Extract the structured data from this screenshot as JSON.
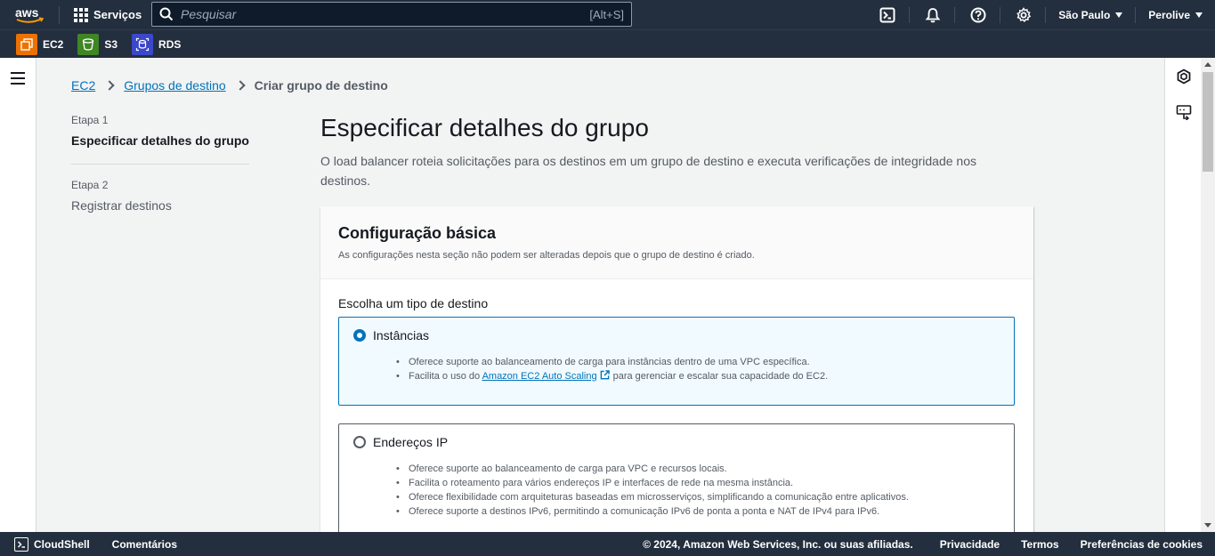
{
  "topnav": {
    "logo_text": "aws",
    "services_label": "Serviços",
    "search_placeholder": "Pesquisar",
    "search_shortcut": "[Alt+S]",
    "region": "São Paulo",
    "account": "Perolive",
    "icons": [
      "cloudshell-icon",
      "bell-icon",
      "help-icon",
      "gear-icon"
    ]
  },
  "favorites": [
    {
      "label": "EC2",
      "color": "#ed7100"
    },
    {
      "label": "S3",
      "color": "#3f8624"
    },
    {
      "label": "RDS",
      "color": "#3b48cc"
    }
  ],
  "breadcrumb": {
    "items": [
      "EC2",
      "Grupos de destino"
    ],
    "current": "Criar grupo de destino"
  },
  "steps": [
    {
      "label": "Etapa 1",
      "title": "Especificar detalhes do grupo",
      "active": true
    },
    {
      "label": "Etapa 2",
      "title": "Registrar destinos",
      "active": false
    }
  ],
  "main": {
    "title": "Especificar detalhes do grupo",
    "description": "O load balancer roteia solicitações para os destinos em um grupo de destino e executa verificações de integridade nos destinos."
  },
  "panel": {
    "title": "Configuração básica",
    "subtitle": "As configurações nesta seção não podem ser alteradas depois que o grupo de destino é criado.",
    "field_label": "Escolha um tipo de destino",
    "options": [
      {
        "label": "Instâncias",
        "selected": true,
        "bullet1": "Oferece suporte ao balanceamento de carga para instâncias dentro de uma VPC específica.",
        "bullet2_pre": "Facilita o uso do",
        "bullet2_link": "Amazon EC2 Auto Scaling",
        "bullet2_post": "para gerenciar e escalar sua capacidade do EC2."
      },
      {
        "label": "Endereços IP",
        "selected": false,
        "bullets": [
          "Oferece suporte ao balanceamento de carga para VPC e recursos locais.",
          "Facilita o roteamento para vários endereços IP e interfaces de rede na mesma instância.",
          "Oferece flexibilidade com arquiteturas baseadas em microsserviços, simplificando a comunicação entre aplicativos.",
          "Oferece suporte a destinos IPv6, permitindo a comunicação IPv6 de ponta a ponta e NAT de IPv4 para IPv6."
        ]
      }
    ]
  },
  "footer": {
    "cloudshell": "CloudShell",
    "comments": "Comentários",
    "copyright": "© 2024, Amazon Web Services, Inc. ou suas afiliadas.",
    "privacy": "Privacidade",
    "terms": "Termos",
    "cookies": "Preferências de cookies"
  },
  "colors": {
    "nav_bg": "#232f3e",
    "link": "#0073bb",
    "selected_bg": "#f1faff"
  }
}
